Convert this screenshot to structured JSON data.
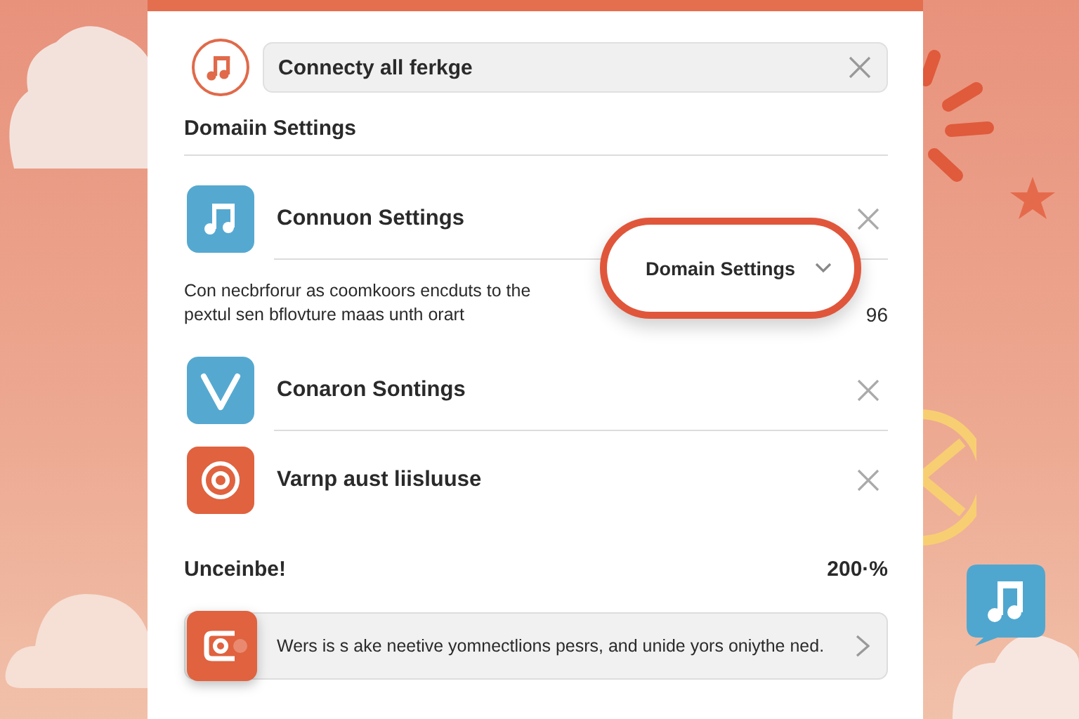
{
  "search": {
    "value": "Connecty all ferkge"
  },
  "section_title": "Domaiin Settings",
  "rows": [
    {
      "kind": "music",
      "label": "Connuon Settings"
    },
    {
      "kind": "check",
      "label": "Conaron Sontings"
    },
    {
      "kind": "at",
      "label": "Varnp aust liisluuse"
    }
  ],
  "description": {
    "lines": [
      "Con necbrforur as coomkoors encduts to the",
      "pextul sen bflovture maas unth orart"
    ],
    "value": "96"
  },
  "dropdown": {
    "label": "Domain Settings"
  },
  "summary": {
    "label": "Unceinbe!",
    "value": "200·%"
  },
  "notice": {
    "text": "Wers is s ake neetive yomnectlions pesrs, and unide yors oniythe ned."
  }
}
